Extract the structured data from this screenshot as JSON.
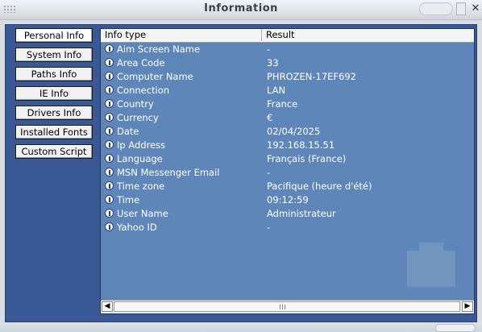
{
  "window": {
    "title": "Information"
  },
  "sidebar": {
    "items": [
      {
        "label": "Personal Info"
      },
      {
        "label": "System Info"
      },
      {
        "label": "Paths Info"
      },
      {
        "label": "IE Info"
      },
      {
        "label": "Drivers Info"
      },
      {
        "label": "Installed Fonts"
      },
      {
        "label": "Custom Script"
      }
    ],
    "active_index": 0
  },
  "list": {
    "columns": [
      "Info type",
      "Result"
    ],
    "rows": [
      {
        "type": "Aim Screen Name",
        "result": "-"
      },
      {
        "type": "Area Code",
        "result": "33"
      },
      {
        "type": "Computer Name",
        "result": "PHROZEN-17EF692"
      },
      {
        "type": "Connection",
        "result": "LAN"
      },
      {
        "type": "Country",
        "result": "France"
      },
      {
        "type": "Currency",
        "result": "€"
      },
      {
        "type": "Date",
        "result": "02/04/2025"
      },
      {
        "type": "Ip Address",
        "result": "192.168.15.51"
      },
      {
        "type": "Language",
        "result": "Français (France)"
      },
      {
        "type": "MSN Messenger Email",
        "result": "-"
      },
      {
        "type": "Time zone",
        "result": "Pacifique (heure d'été)"
      },
      {
        "type": "Time",
        "result": "09:12:59"
      },
      {
        "type": "User Name",
        "result": "Administrateur"
      },
      {
        "type": "Yahoo ID",
        "result": "-"
      }
    ]
  },
  "colors": {
    "panel": "#3a5896",
    "list_background": "#5e86b8",
    "row_text": "#ffffff"
  }
}
